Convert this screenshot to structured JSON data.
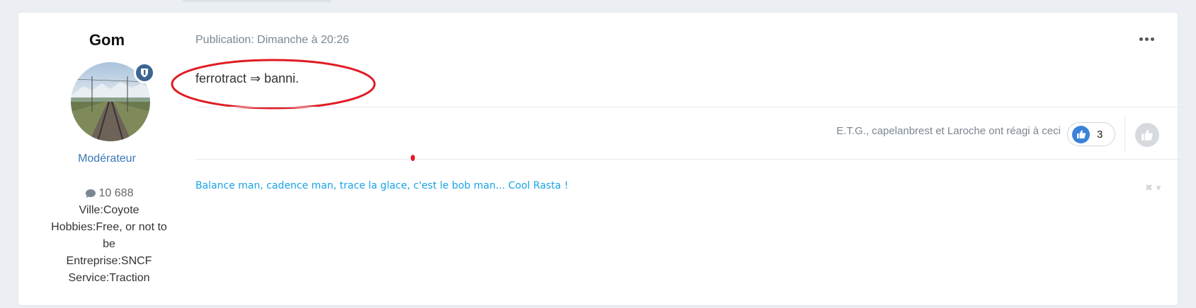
{
  "author": {
    "name": "Gom",
    "avatar_icon": "railway-track-photo",
    "badge_icon": "moderator-shield-icon",
    "group": "Modérateur",
    "post_count": "10 688",
    "fields": [
      "Ville:Coyote",
      "Hobbies:Free, or not to be",
      "Entreprise:SNCF",
      "Service:Traction"
    ]
  },
  "post": {
    "meta": "Publication: Dimanche à 20:26",
    "content": "ferrotract ⇒ banni.",
    "menu_icon": "ellipsis-icon"
  },
  "reactions": {
    "text": "E.T.G., capelanbrest et Laroche ont réagi à ceci",
    "count": "3",
    "icon": "thumbs-up-icon"
  },
  "signature": {
    "text": "Balance man, cadence man, trace la glace, c'est le bob man... Cool Rasta !"
  },
  "colors": {
    "accent": "#3b78b7",
    "signature": "#1aa3e6",
    "annotation": "#e01b24",
    "badge": "#3d6594"
  }
}
